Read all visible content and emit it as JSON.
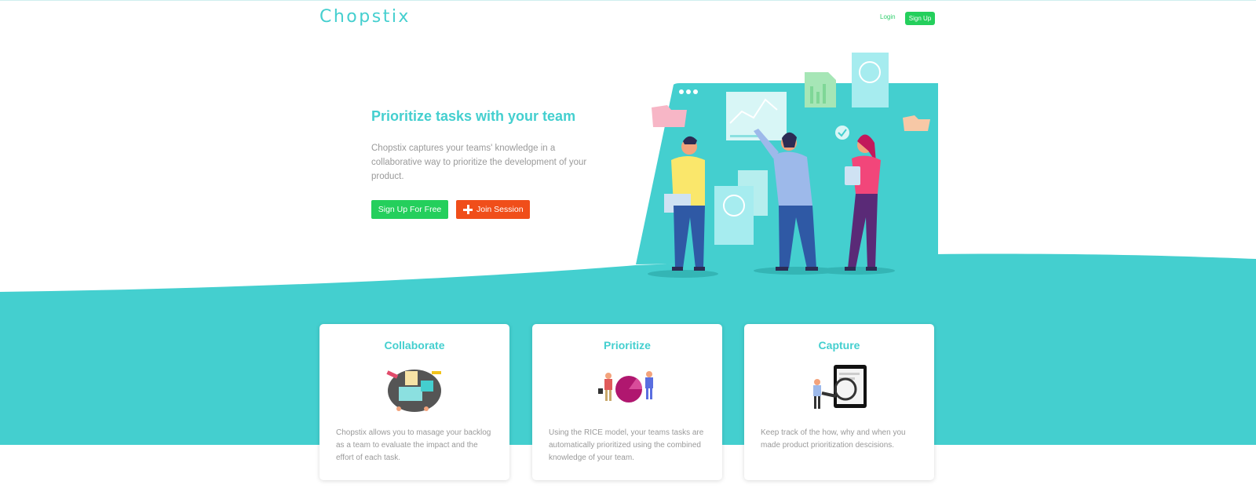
{
  "header": {
    "logo": "Chopstix",
    "login_label": "Login",
    "signup_label": "Sign Up"
  },
  "hero": {
    "title": "Prioritize tasks with your team",
    "description": "Chopstix captures your teams' knowledge in a collaborative way to prioritize the development of your product.",
    "signup_free_label": "Sign Up For Free",
    "join_session_label": "Join Session"
  },
  "features": [
    {
      "title": "Collaborate",
      "text": "Chopstix allows you to masage your backlog as a team to evaluate the impact and the effort of each task.",
      "icon": "collaborate-illustration"
    },
    {
      "title": "Prioritize",
      "text": "Using the RICE model, your teams tasks are automatically prioritized using the combined knowledge of your team.",
      "icon": "prioritize-illustration"
    },
    {
      "title": "Capture",
      "text": "Keep track of the how, why and when you made product prioritization descisions.",
      "icon": "capture-illustration"
    }
  ],
  "colors": {
    "brand_teal": "#44cfcf",
    "green": "#24cf5c",
    "orange": "#f04e1a",
    "text_gray": "#9a9a9a"
  }
}
